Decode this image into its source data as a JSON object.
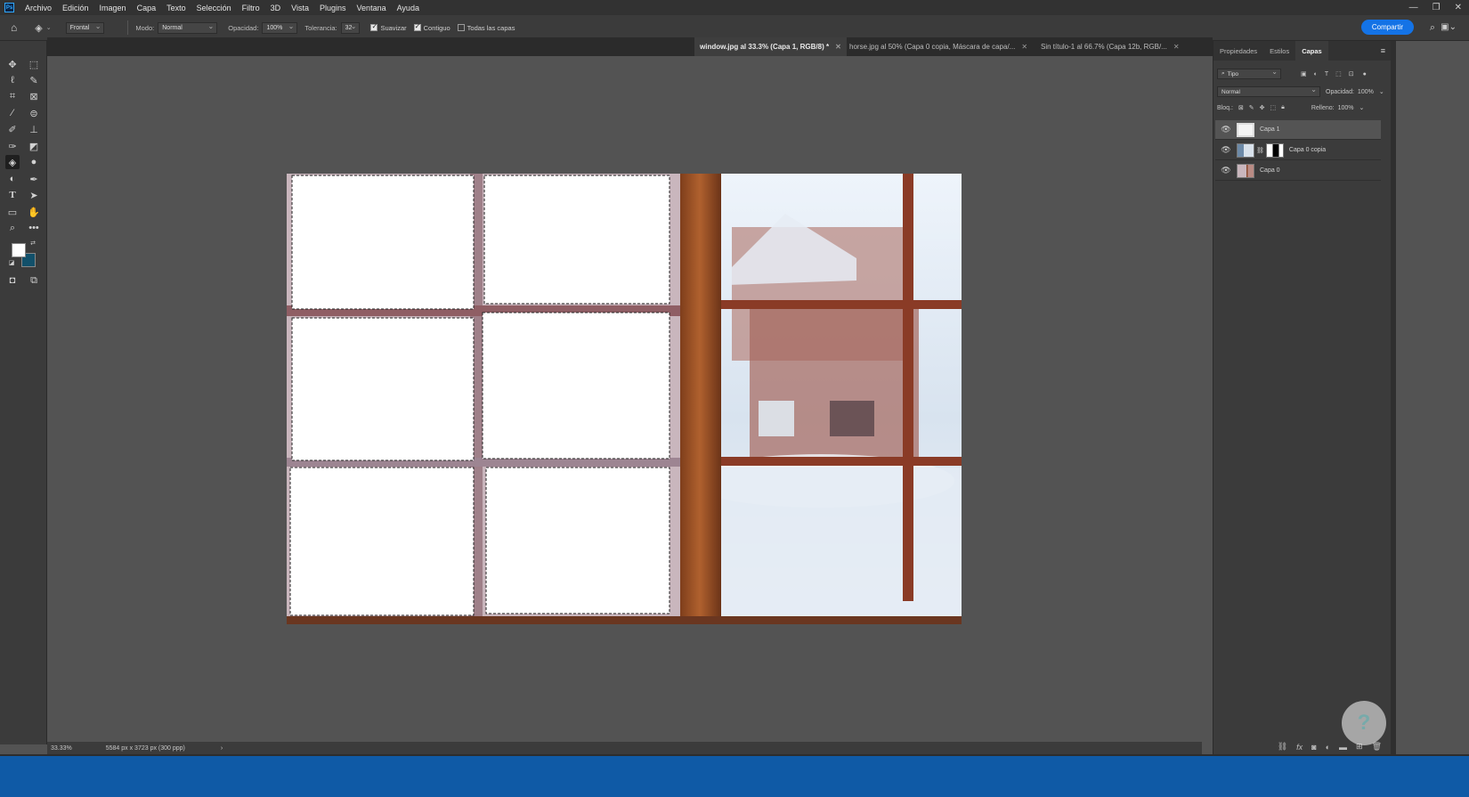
{
  "app": {
    "logo": "Ps"
  },
  "menu": [
    "Archivo",
    "Edición",
    "Imagen",
    "Capa",
    "Texto",
    "Selección",
    "Filtro",
    "3D",
    "Vista",
    "Plugins",
    "Ventana",
    "Ayuda"
  ],
  "options": {
    "preset": "Frontal",
    "mode_label": "Modo:",
    "mode_value": "Normal",
    "opacity_label": "Opacidad:",
    "opacity_value": "100%",
    "tolerance_label": "Tolerancia:",
    "tolerance_value": "32",
    "smooth_label": "Suavizar",
    "contiguous_label": "Contiguo",
    "all_layers_label": "Todas las capas",
    "share_label": "Compartir"
  },
  "tabs": [
    {
      "label": "window.jpg al 33.3% (Capa 1, RGB/8) *"
    },
    {
      "label": "horse.jpg al 50% (Capa 0 copia, Máscara de capa/..."
    },
    {
      "label": "Sin título-1 al 66.7% (Capa 12b, RGB/..."
    }
  ],
  "status": {
    "zoom": "33.33%",
    "dimensions": "5584 px x 3723 px (300 ppp)"
  },
  "panel": {
    "tabs": [
      "Propiedades",
      "Estilos",
      "Capas"
    ],
    "filter_label": "Tipo",
    "blend_mode": "Normal",
    "opacity_label": "Opacidad:",
    "opacity_value": "100%",
    "lock_label": "Bloq.:",
    "fill_label": "Relleno:",
    "fill_value": "100%",
    "layers": [
      {
        "name": "Capa 1"
      },
      {
        "name": "Capa 0 copia"
      },
      {
        "name": "Capa 0"
      }
    ]
  },
  "colors": {
    "foreground": "#ffffff",
    "background": "#12506a",
    "accent": "#1473e6"
  }
}
